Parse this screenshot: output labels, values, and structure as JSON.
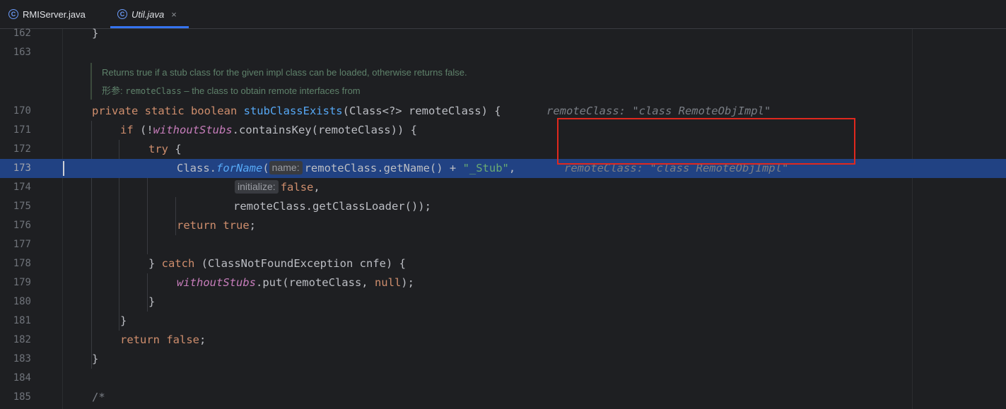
{
  "tabs": [
    {
      "label": "RMIServer.java",
      "active": false
    },
    {
      "label": "Util.java",
      "active": true,
      "close": "×"
    }
  ],
  "tab_icon": "C",
  "doc_comment": {
    "line1": "Returns true if a stub class for the given impl class can be loaded, otherwise returns false.",
    "line2_label": "形参:",
    "line2_param": "remoteClass",
    "line2_text": " – the class to obtain remote interfaces from"
  },
  "line_numbers": {
    "l162": "162",
    "l163": "163",
    "l170": "170",
    "l171": "171",
    "l172": "172",
    "l173": "173",
    "l174": "174",
    "l175": "175",
    "l176": "176",
    "l177": "177",
    "l178": "178",
    "l179": "179",
    "l180": "180",
    "l181": "181",
    "l182": "182",
    "l183": "183",
    "l184": "184",
    "l185": "185"
  },
  "code": {
    "l162": "}",
    "l170": {
      "kw1": "private static boolean ",
      "fn": "stubClassExists",
      "rest": "(Class<?> remoteClass) {",
      "inlay": "remoteClass: \"class RemoteObjImpl\""
    },
    "l171": {
      "kw": "if",
      "p1": " (!",
      "field": "withoutStubs",
      "p2": ".containsKey(remoteClass)) {"
    },
    "l172": {
      "kw": "try",
      "p1": " {"
    },
    "l173": {
      "p1": "Class.",
      "fn": "forName",
      "p2": "(",
      "hint": "name:",
      "p3": "remoteClass.getName() + ",
      "str": "\"_Stub\"",
      "p4": ",",
      "inlay": "remoteClass: \"class RemoteObjImpl\""
    },
    "l174": {
      "hint": "initialize:",
      "kw": "false",
      "p1": ","
    },
    "l175": "remoteClass.getClassLoader());",
    "l176": {
      "kw1": "return ",
      "kw2": "true",
      "p1": ";"
    },
    "l178": {
      "p1": "} ",
      "kw": "catch",
      "p2": " (ClassNotFoundException cnfe) {"
    },
    "l179": {
      "field": "withoutStubs",
      "p1": ".put(remoteClass, ",
      "kw": "null",
      "p2": ");"
    },
    "l180": "}",
    "l181": "}",
    "l182": {
      "kw1": "return ",
      "kw2": "false",
      "p1": ";"
    },
    "l183": "}",
    "l185": "/*"
  },
  "colors": {
    "background": "#1e1f22",
    "selection": "#214283",
    "keyword": "#cf8e6d",
    "function": "#56a8f5",
    "field": "#c77dbb",
    "string": "#6aab73",
    "annotation_box": "#e0281e"
  }
}
